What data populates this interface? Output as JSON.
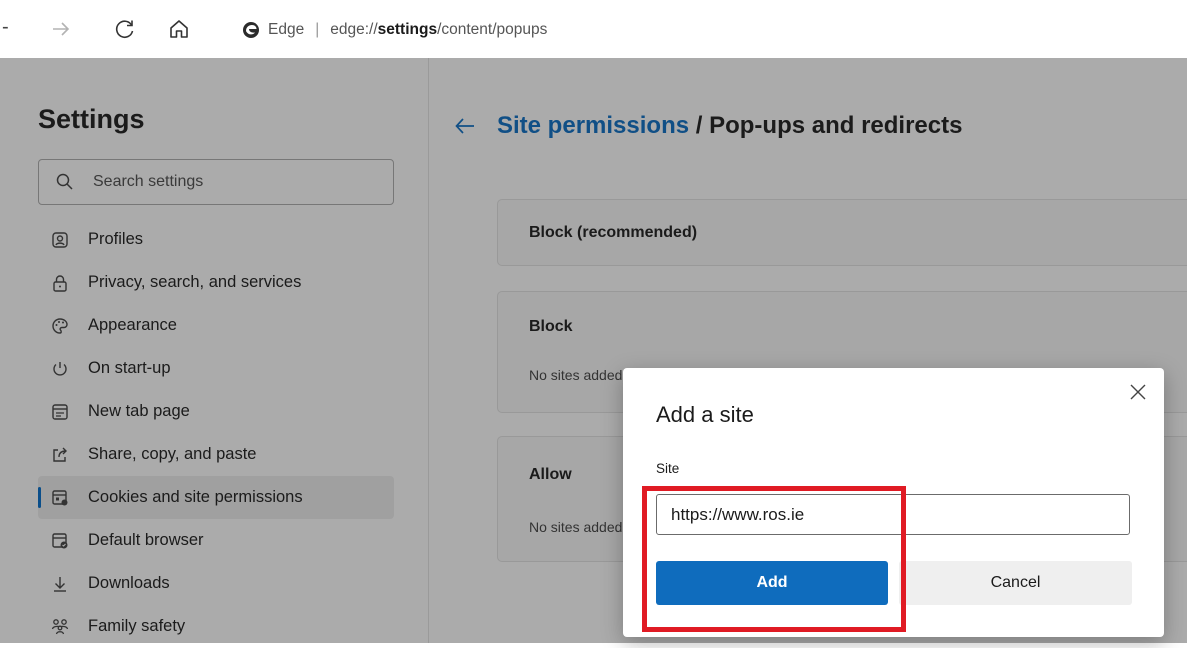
{
  "toolbar": {
    "back_icon": "back-arrow-icon",
    "forward_icon": "forward-arrow-icon",
    "refresh_icon": "refresh-icon",
    "home_icon": "home-icon",
    "site_name": "Edge",
    "url_prefix": "edge://",
    "url_bold": "settings",
    "url_suffix": "/content/popups"
  },
  "sidebar": {
    "title": "Settings",
    "search_placeholder": "Search settings",
    "items": [
      {
        "label": "Profiles",
        "icon": "profile-icon"
      },
      {
        "label": "Privacy, search, and services",
        "icon": "lock-icon"
      },
      {
        "label": "Appearance",
        "icon": "palette-icon"
      },
      {
        "label": "On start-up",
        "icon": "power-icon"
      },
      {
        "label": "New tab page",
        "icon": "new-tab-icon"
      },
      {
        "label": "Share, copy, and paste",
        "icon": "share-icon"
      },
      {
        "label": "Cookies and site permissions",
        "icon": "cookies-icon",
        "active": true
      },
      {
        "label": "Default browser",
        "icon": "default-browser-icon"
      },
      {
        "label": "Downloads",
        "icon": "download-icon"
      },
      {
        "label": "Family safety",
        "icon": "family-icon"
      }
    ]
  },
  "main": {
    "breadcrumb_link": "Site permissions",
    "breadcrumb_rest": " / Pop-ups and redirects",
    "block_recommended": "Block (recommended)",
    "block_title": "Block",
    "block_empty": "No sites added",
    "allow_title": "Allow",
    "allow_empty": "No sites added"
  },
  "dialog": {
    "title": "Add a site",
    "site_label": "Site",
    "site_value": "https://www.ros.ie",
    "add_label": "Add",
    "cancel_label": "Cancel"
  },
  "colors": {
    "accent": "#0f6cbd",
    "link": "#104f86",
    "highlight": "#e01b24",
    "overlay": "#ababab"
  }
}
